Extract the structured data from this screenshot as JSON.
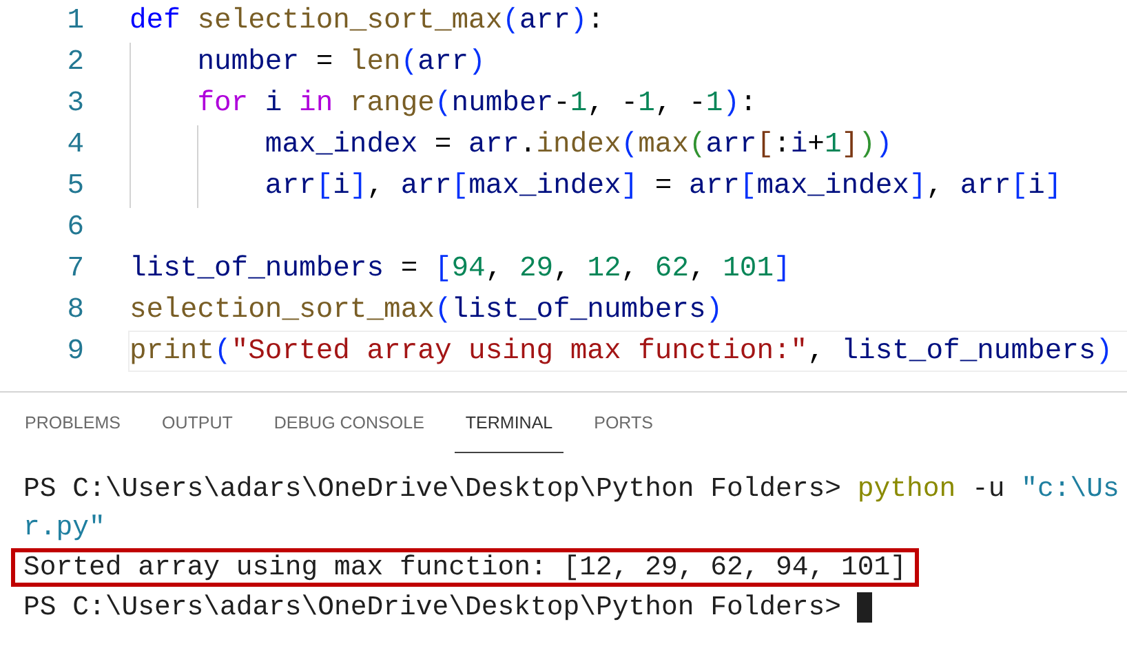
{
  "editor": {
    "lines": [
      {
        "number": "1",
        "current": false,
        "tokens": [
          {
            "kind": "keyword",
            "text": "def "
          },
          {
            "kind": "func",
            "text": "selection_sort_max"
          },
          {
            "kind": "b1",
            "text": "("
          },
          {
            "kind": "var",
            "text": "arr"
          },
          {
            "kind": "b1",
            "text": ")"
          },
          {
            "kind": "plain",
            "text": ":"
          }
        ],
        "children": [
          {
            "number": "2",
            "current": false,
            "tokens": [
              {
                "kind": "var",
                "text": "number"
              },
              {
                "kind": "plain",
                "text": " = "
              },
              {
                "kind": "func",
                "text": "len"
              },
              {
                "kind": "b1",
                "text": "("
              },
              {
                "kind": "var",
                "text": "arr"
              },
              {
                "kind": "b1",
                "text": ")"
              }
            ]
          },
          {
            "number": "3",
            "current": false,
            "tokens": [
              {
                "kind": "control",
                "text": "for "
              },
              {
                "kind": "var",
                "text": "i "
              },
              {
                "kind": "control",
                "text": "in "
              },
              {
                "kind": "func",
                "text": "range"
              },
              {
                "kind": "b1",
                "text": "("
              },
              {
                "kind": "var",
                "text": "number"
              },
              {
                "kind": "plain",
                "text": "-"
              },
              {
                "kind": "num",
                "text": "1"
              },
              {
                "kind": "plain",
                "text": ", -"
              },
              {
                "kind": "num",
                "text": "1"
              },
              {
                "kind": "plain",
                "text": ", -"
              },
              {
                "kind": "num",
                "text": "1"
              },
              {
                "kind": "b1",
                "text": ")"
              },
              {
                "kind": "plain",
                "text": ":"
              }
            ],
            "children": [
              {
                "number": "4",
                "current": false,
                "tokens": [
                  {
                    "kind": "var",
                    "text": "max_index"
                  },
                  {
                    "kind": "plain",
                    "text": " = "
                  },
                  {
                    "kind": "var",
                    "text": "arr"
                  },
                  {
                    "kind": "plain",
                    "text": "."
                  },
                  {
                    "kind": "func",
                    "text": "index"
                  },
                  {
                    "kind": "b1",
                    "text": "("
                  },
                  {
                    "kind": "func",
                    "text": "max"
                  },
                  {
                    "kind": "b2",
                    "text": "("
                  },
                  {
                    "kind": "var",
                    "text": "arr"
                  },
                  {
                    "kind": "b3",
                    "text": "["
                  },
                  {
                    "kind": "plain",
                    "text": ":"
                  },
                  {
                    "kind": "var",
                    "text": "i"
                  },
                  {
                    "kind": "plain",
                    "text": "+"
                  },
                  {
                    "kind": "num",
                    "text": "1"
                  },
                  {
                    "kind": "b3",
                    "text": "]"
                  },
                  {
                    "kind": "b2",
                    "text": ")"
                  },
                  {
                    "kind": "b1",
                    "text": ")"
                  }
                ]
              },
              {
                "number": "5",
                "current": false,
                "tokens": [
                  {
                    "kind": "var",
                    "text": "arr"
                  },
                  {
                    "kind": "b1",
                    "text": "["
                  },
                  {
                    "kind": "var",
                    "text": "i"
                  },
                  {
                    "kind": "b1",
                    "text": "]"
                  },
                  {
                    "kind": "plain",
                    "text": ", "
                  },
                  {
                    "kind": "var",
                    "text": "arr"
                  },
                  {
                    "kind": "b1",
                    "text": "["
                  },
                  {
                    "kind": "var",
                    "text": "max_index"
                  },
                  {
                    "kind": "b1",
                    "text": "]"
                  },
                  {
                    "kind": "plain",
                    "text": " = "
                  },
                  {
                    "kind": "var",
                    "text": "arr"
                  },
                  {
                    "kind": "b1",
                    "text": "["
                  },
                  {
                    "kind": "var",
                    "text": "max_index"
                  },
                  {
                    "kind": "b1",
                    "text": "]"
                  },
                  {
                    "kind": "plain",
                    "text": ", "
                  },
                  {
                    "kind": "var",
                    "text": "arr"
                  },
                  {
                    "kind": "b1",
                    "text": "["
                  },
                  {
                    "kind": "var",
                    "text": "i"
                  },
                  {
                    "kind": "b1",
                    "text": "]"
                  }
                ]
              }
            ]
          }
        ]
      },
      {
        "number": "6",
        "current": false
      },
      {
        "number": "7",
        "current": false,
        "tokens": [
          {
            "kind": "var",
            "text": "list_of_numbers"
          },
          {
            "kind": "plain",
            "text": " = "
          },
          {
            "kind": "b1",
            "text": "["
          },
          {
            "kind": "num",
            "text": "94"
          },
          {
            "kind": "plain",
            "text": ", "
          },
          {
            "kind": "num",
            "text": "29"
          },
          {
            "kind": "plain",
            "text": ", "
          },
          {
            "kind": "num",
            "text": "12"
          },
          {
            "kind": "plain",
            "text": ", "
          },
          {
            "kind": "num",
            "text": "62"
          },
          {
            "kind": "plain",
            "text": ", "
          },
          {
            "kind": "num",
            "text": "101"
          },
          {
            "kind": "b1",
            "text": "]"
          }
        ]
      },
      {
        "number": "8",
        "current": false,
        "tokens": [
          {
            "kind": "func",
            "text": "selection_sort_max"
          },
          {
            "kind": "b1",
            "text": "("
          },
          {
            "kind": "var",
            "text": "list_of_numbers"
          },
          {
            "kind": "b1",
            "text": ")"
          }
        ]
      },
      {
        "number": "9",
        "current": true,
        "tokens": [
          {
            "kind": "func",
            "text": "print"
          },
          {
            "kind": "b1",
            "text": "("
          },
          {
            "kind": "str",
            "text": "\"Sorted array using max function:\""
          },
          {
            "kind": "plain",
            "text": ", "
          },
          {
            "kind": "var",
            "text": "list_of_numbers"
          },
          {
            "kind": "b1",
            "text": ")"
          }
        ]
      }
    ]
  },
  "panel": {
    "tabs": [
      {
        "label": "PROBLEMS",
        "selected": false
      },
      {
        "label": "OUTPUT",
        "selected": false
      },
      {
        "label": "DEBUG CONSOLE",
        "selected": false
      },
      {
        "label": "TERMINAL",
        "selected": true
      },
      {
        "label": "PORTS",
        "selected": false
      }
    ],
    "terminal": {
      "lines": [
        {
          "highlighted": false,
          "cursor": false,
          "tokens": [
            {
              "kind": "plain",
              "text": "PS C:\\Users\\adars\\OneDrive\\Desktop\\Python Folders> "
            },
            {
              "kind": "cmd",
              "text": "python"
            },
            {
              "kind": "plain",
              "text": " -u "
            },
            {
              "kind": "str",
              "text": "\"c:\\Us"
            }
          ]
        },
        {
          "highlighted": false,
          "cursor": false,
          "tokens": [
            {
              "kind": "str",
              "text": "r.py\""
            }
          ]
        },
        {
          "highlighted": true,
          "cursor": false,
          "tokens": [
            {
              "kind": "plain",
              "text": "Sorted array using max function: [12, 29, 62, 94, 101]"
            }
          ]
        },
        {
          "highlighted": false,
          "cursor": true,
          "tokens": [
            {
              "kind": "plain",
              "text": "PS C:\\Users\\adars\\OneDrive\\Desktop\\Python Folders> "
            }
          ]
        }
      ]
    }
  }
}
